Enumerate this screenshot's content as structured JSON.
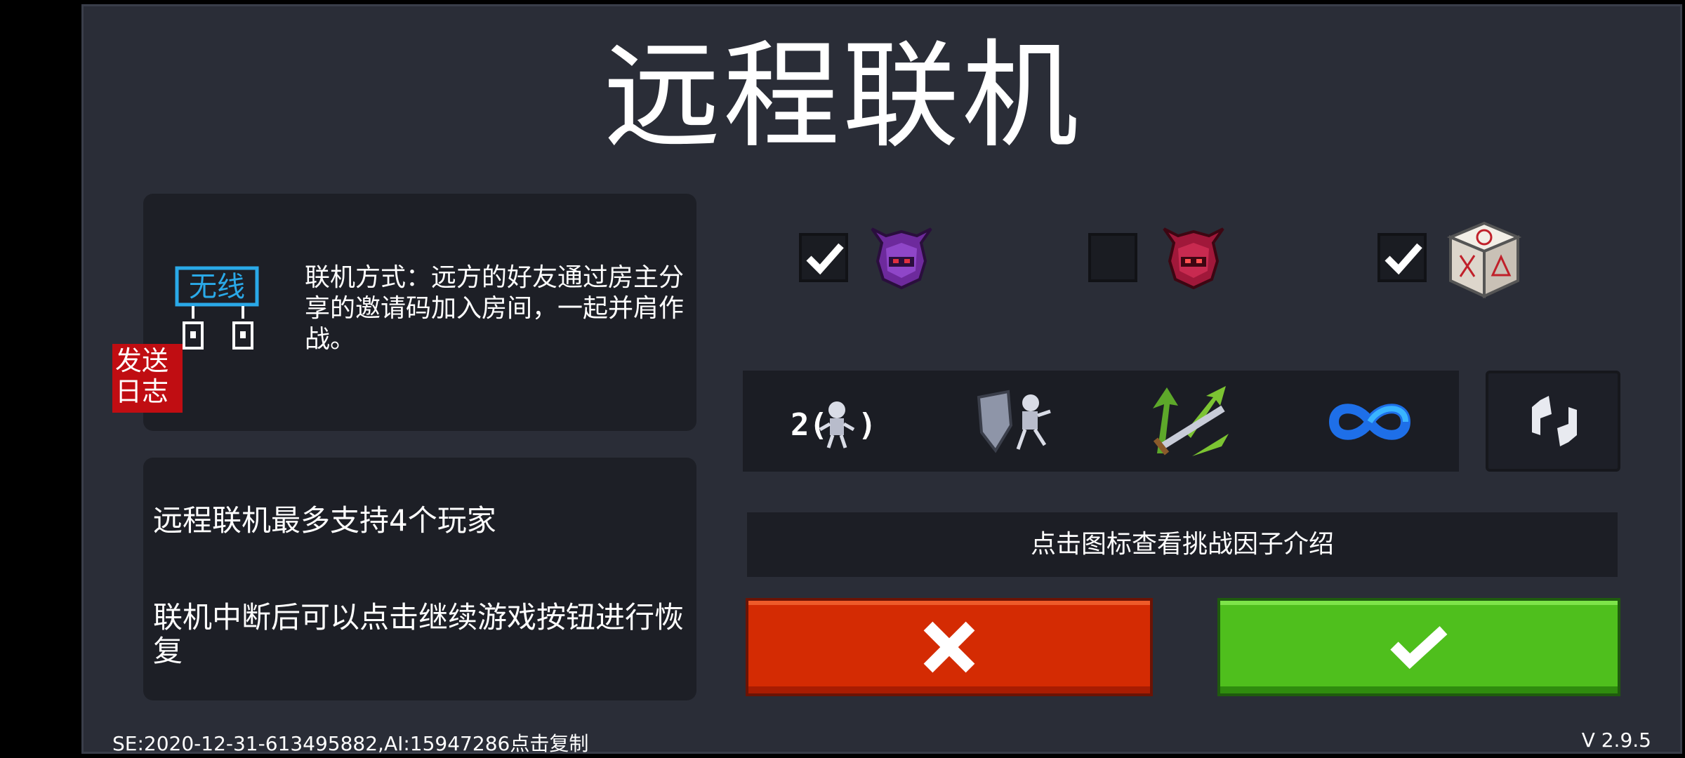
{
  "title": "远程联机",
  "connection": {
    "icon_label": "无线",
    "description": "联机方式：远方的好友通过房主分享的邀请码加入房间，一起并肩作战。"
  },
  "send_log_button": "发送日志",
  "tips": [
    "远程联机最多支持4个玩家",
    "联机中断后可以点击继续游戏按钮进行恢复"
  ],
  "options": [
    {
      "icon": "purple-helmet-icon",
      "checked": true
    },
    {
      "icon": "red-helmet-icon",
      "checked": false
    },
    {
      "icon": "dice-icon",
      "checked": true
    }
  ],
  "challenge_factors": [
    {
      "icon": "double-enemy-icon",
      "label": "2("
    },
    {
      "icon": "shield-skeleton-icon"
    },
    {
      "icon": "sword-arrows-icon"
    },
    {
      "icon": "infinity-icon"
    }
  ],
  "hint": "点击图标查看挑战因子介绍",
  "footer": {
    "seed": "SE:2020-12-31-613495882,AI:15947286点击复制",
    "version": "V 2.9.5"
  },
  "colors": {
    "cancel": "#d42b03",
    "confirm": "#4fbf1d",
    "log_button": "#c00d12",
    "panel": "#2a2d37"
  }
}
